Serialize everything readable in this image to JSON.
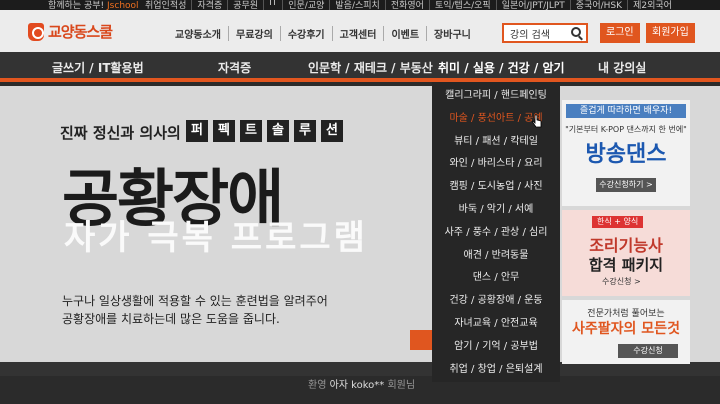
{
  "topbar": {
    "promo_prefix": "함께하는 공부!",
    "promo_brand": "Jschool",
    "links": [
      "취업인적성",
      "자격증",
      "공무원",
      "IT",
      "인문/교양",
      "발음/스피치",
      "전화영어",
      "토익/텝스/오픽",
      "일본어/JPT/JLPT",
      "중국어/HSK",
      "제2외국어"
    ]
  },
  "header": {
    "logo_text": "교양동스쿨",
    "nav": [
      "교양동소개",
      "무료강의",
      "수강후기",
      "고객센터",
      "이벤트",
      "장바구니"
    ],
    "search_placeholder": "강의 검색",
    "login_label": "로그인",
    "join_label": "회원가입"
  },
  "categories": [
    "글쓰기 / IT활용법",
    "자격증",
    "인문학 / 재테크 / 부동산",
    "취미 / 실용 / 건강 / 암기",
    "내 강의실"
  ],
  "dropdown": {
    "items": [
      "캘리그라피 / 핸드페인팅",
      "마술 / 풍선아트 / 공예",
      "뷰티 / 패션 / 칵테일",
      "와인 / 바리스타 / 요리",
      "캠핑 / 도시농업 / 사진",
      "바둑 / 악기 / 서예",
      "사주 / 풍수 / 관상 / 심리",
      "애견 / 반려동물",
      "댄스 / 안무",
      "건강 / 공황장애 / 운동",
      "자녀교육 / 안전교육",
      "암기 / 기억 / 공부법",
      "취업 / 창업 / 은퇴설계"
    ],
    "hover_index": 1
  },
  "banner": {
    "tagline": "진짜 정신과 의사의",
    "boxes": [
      "퍼",
      "펙",
      "트",
      "솔",
      "루",
      "션"
    ],
    "title": "공황장애",
    "subtitle": "자가 극복 프로그램",
    "desc1": "누구나 일상생활에 적용할 수 있는 훈련법을 알려주어",
    "desc2": "공황장애를 치료하는데 많은 도움을 줍니다."
  },
  "userline": {
    "prefix": "환영",
    "name": "아자 koko**",
    "suffix": "회원님"
  },
  "side_banners": {
    "dance": {
      "top": "즐겁게 따라하면 배우자!",
      "mid": "\"기본부터 K-POP 댄스까지 한 번에\"",
      "big": "방송댄스",
      "cta": "수강신청하기 >"
    },
    "cook": {
      "tag": "한식 + 양식",
      "l1": "조리기능사",
      "l2": "합격 패키지",
      "cta": "수강신청 >"
    },
    "saju": {
      "l1": "전문가처럼 풀어보는",
      "l2": "사주팔자의 모든것",
      "cta": "수강신청"
    }
  },
  "colors": {
    "accent": "#e0561f",
    "dark": "#333333",
    "dropdown_bg": "#262626"
  }
}
